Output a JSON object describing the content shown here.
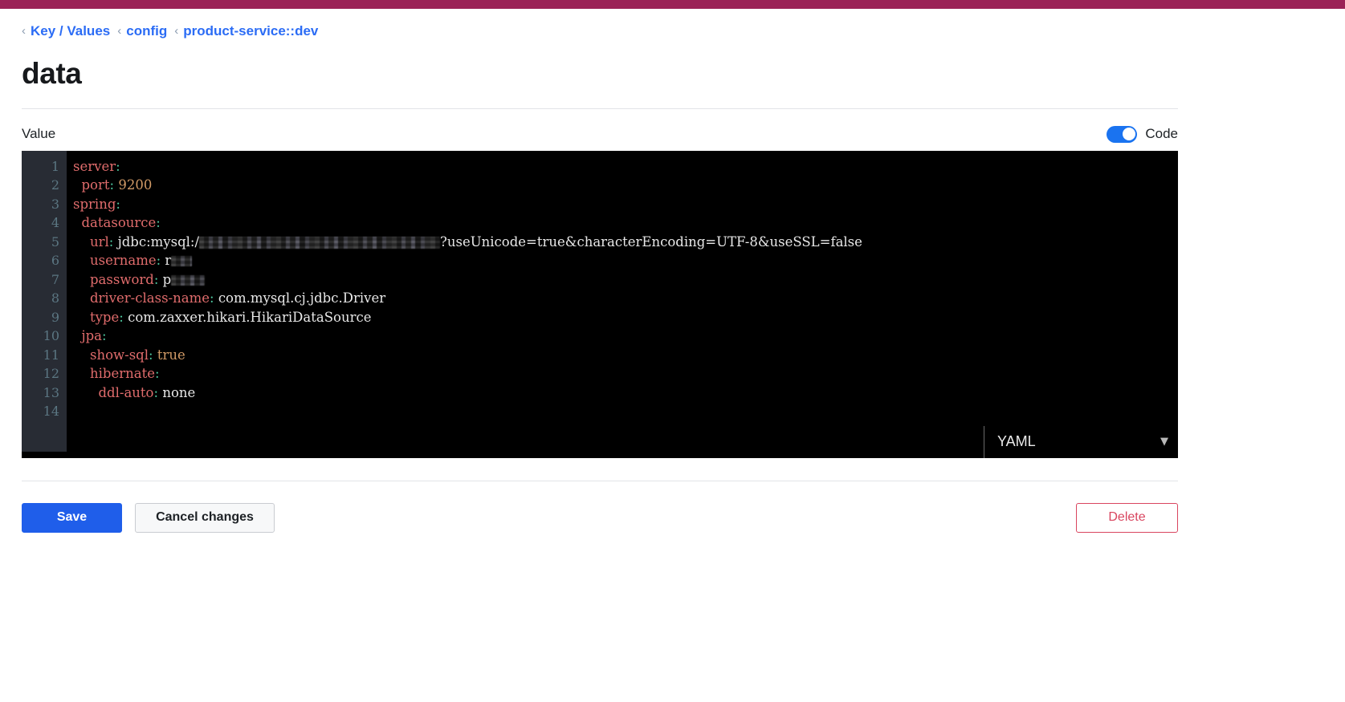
{
  "theme": {
    "topbar_color": "#9b2257",
    "accent_blue": "#1f5eea",
    "link_blue": "#2b6cf5",
    "danger_red": "#d9455f",
    "editor_bg": "#000000",
    "gutter_bg": "#282c34"
  },
  "breadcrumb": {
    "separator": "‹",
    "items": [
      {
        "label": "Key / Values"
      },
      {
        "label": "config"
      },
      {
        "label": "product-service::dev"
      }
    ]
  },
  "page_title": "data",
  "value_section": {
    "label": "Value",
    "code_toggle_label": "Code",
    "code_toggle_on": true
  },
  "editor": {
    "language": "YAML",
    "caret_glyph": "▼",
    "total_lines": 14,
    "line_numbers": [
      1,
      2,
      3,
      4,
      5,
      6,
      7,
      8,
      9,
      10,
      11,
      12,
      13,
      14
    ],
    "lines": [
      {
        "n": 1,
        "indent": 0,
        "key": "server",
        "colon": ":",
        "value": "",
        "value_type": "none"
      },
      {
        "n": 2,
        "indent": 1,
        "key": "port",
        "colon": ":",
        "value": "9200",
        "value_type": "number"
      },
      {
        "n": 3,
        "indent": 0,
        "key": "spring",
        "colon": ":",
        "value": "",
        "value_type": "none"
      },
      {
        "n": 4,
        "indent": 1,
        "key": "datasource",
        "colon": ":",
        "value": "",
        "value_type": "none"
      },
      {
        "n": 5,
        "indent": 2,
        "key": "url",
        "colon": ":",
        "value_prefix": "jdbc:mysql:/",
        "redacted": true,
        "value_suffix": "?useUnicode=true&characterEncoding=UTF-8&useSSL=false",
        "value_type": "redacted"
      },
      {
        "n": 6,
        "indent": 2,
        "key": "username",
        "colon": ":",
        "value_prefix": "r",
        "redacted": true,
        "value_suffix": "",
        "value_type": "redacted"
      },
      {
        "n": 7,
        "indent": 2,
        "key": "password",
        "colon": ":",
        "value_prefix": "p",
        "redacted": true,
        "value_suffix": "",
        "value_type": "redacted"
      },
      {
        "n": 8,
        "indent": 2,
        "key": "driver-class-name",
        "colon": ":",
        "value": "com.mysql.cj.jdbc.Driver",
        "value_type": "string"
      },
      {
        "n": 9,
        "indent": 2,
        "key": "type",
        "colon": ":",
        "value": "com.zaxxer.hikari.HikariDataSource",
        "value_type": "string"
      },
      {
        "n": 10,
        "indent": 1,
        "key": "jpa",
        "colon": ":",
        "value": "",
        "value_type": "none"
      },
      {
        "n": 11,
        "indent": 2,
        "key": "show-sql",
        "colon": ":",
        "value": "true",
        "value_type": "boolean"
      },
      {
        "n": 12,
        "indent": 2,
        "key": "hibernate",
        "colon": ":",
        "value": "",
        "value_type": "none"
      },
      {
        "n": 13,
        "indent": 3,
        "key": "ddl-auto",
        "colon": ":",
        "value": "none",
        "value_type": "string"
      },
      {
        "n": 14,
        "indent": 0,
        "key": "",
        "colon": "",
        "value": "",
        "value_type": "none"
      }
    ]
  },
  "actions": {
    "save_label": "Save",
    "cancel_label": "Cancel changes",
    "delete_label": "Delete"
  }
}
